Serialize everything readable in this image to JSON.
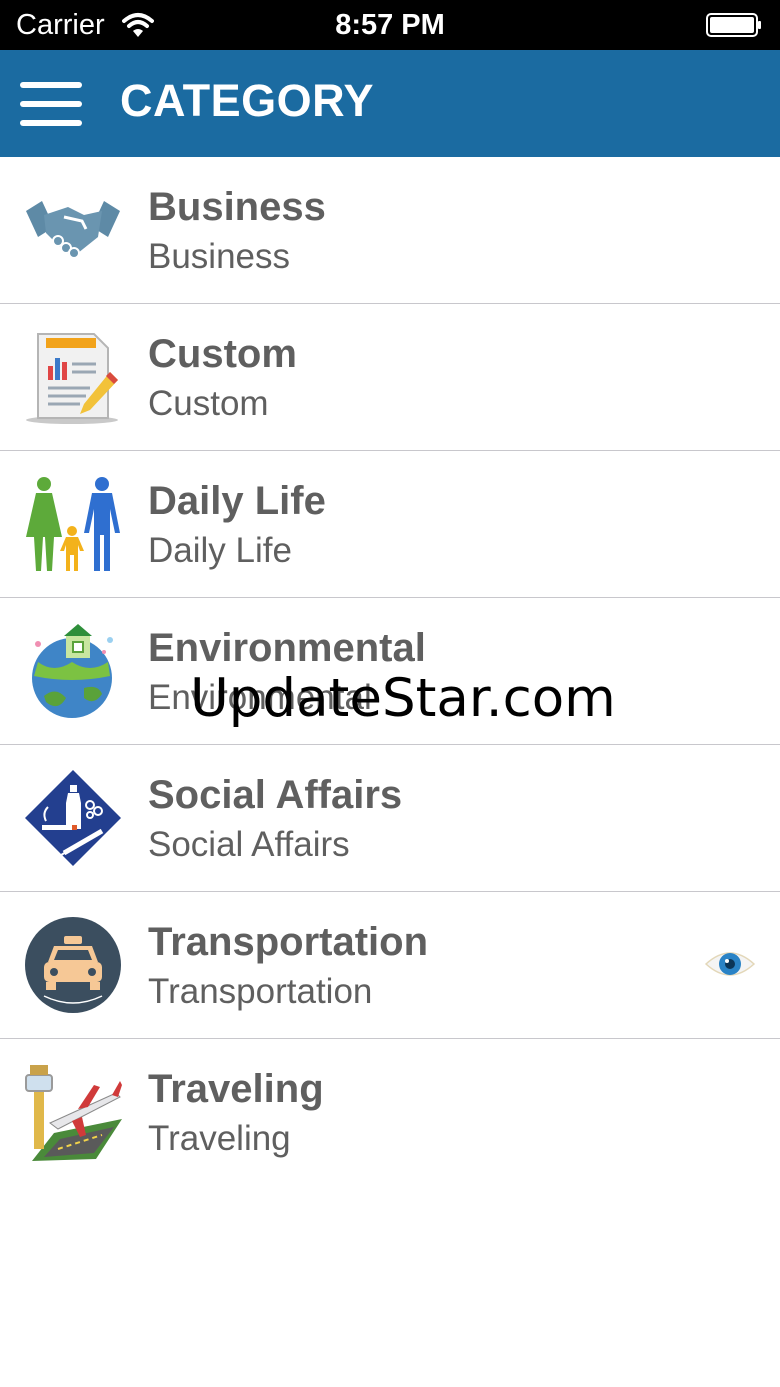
{
  "status_bar": {
    "carrier": "Carrier",
    "time": "8:57 PM"
  },
  "header": {
    "title": "CATEGORY",
    "menu_icon": "hamburger-menu-icon",
    "background": "#1b6ba1"
  },
  "categories": [
    {
      "title": "Business",
      "subtitle": "Business",
      "icon": "handshake-icon"
    },
    {
      "title": "Custom",
      "subtitle": "Custom",
      "icon": "report-document-icon"
    },
    {
      "title": "Daily Life",
      "subtitle": "Daily Life",
      "icon": "family-icon"
    },
    {
      "title": "Environmental",
      "subtitle": "Environmental",
      "icon": "earth-house-icon"
    },
    {
      "title": "Social Affairs",
      "subtitle": "Social Affairs",
      "icon": "addiction-warning-icon"
    },
    {
      "title": "Transportation",
      "subtitle": "Transportation",
      "icon": "taxi-icon",
      "marker_icon": "eye-icon"
    },
    {
      "title": "Traveling",
      "subtitle": "Traveling",
      "icon": "airport-icon"
    }
  ],
  "watermark": "UpdateStar.com"
}
